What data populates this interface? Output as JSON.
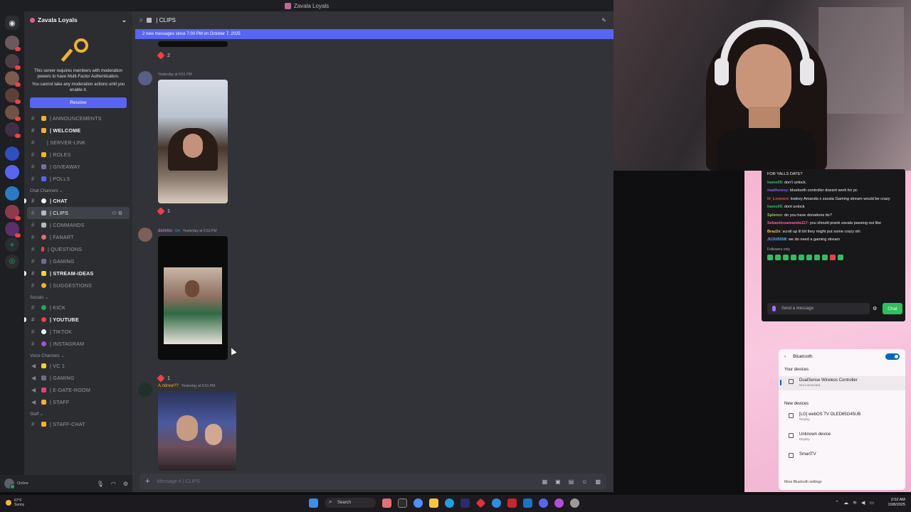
{
  "window_title": "Zavala Loyals",
  "server": {
    "name": "Zavala Loyals"
  },
  "mfa": {
    "line1": "This server requires members with moderation powers to have Multi-Factor Authentication.",
    "line2": "You cannot take any moderation actions until you enable it.",
    "button": "Resolve"
  },
  "channels_top": [
    {
      "label": "| ANNOUNCEMENTS",
      "color": "#f0b232"
    },
    {
      "label": "| WELCOME",
      "color": "#f0b232"
    },
    {
      "label": "| SERVER-LINK",
      "color": "#949ba4"
    },
    {
      "label": "| ROLES",
      "color": "#f0b232"
    },
    {
      "label": "| GIVEAWAY",
      "color": "#949ba4"
    },
    {
      "label": "| POLLS",
      "color": "#5865f2"
    }
  ],
  "cat_chat": "Chat Channels",
  "channels_chat": [
    {
      "label": "| CHAT"
    },
    {
      "label": "| CLIPS"
    },
    {
      "label": "| COMMANDS"
    },
    {
      "label": "| FANART"
    },
    {
      "label": "| QUESTIONS"
    },
    {
      "label": "| GAMING"
    },
    {
      "label": "| STREAM-IDEAS"
    },
    {
      "label": "| SUGGESTIONS"
    }
  ],
  "cat_socials": "Socials",
  "channels_socials": [
    {
      "label": "| KICK"
    },
    {
      "label": "| YOUTUBE"
    },
    {
      "label": "| TIKTOK"
    },
    {
      "label": "| INSTAGRAM"
    }
  ],
  "cat_voice": "Voice Channels",
  "channels_voice": [
    {
      "label": "| VC 1"
    },
    {
      "label": "| GAMING"
    },
    {
      "label": "| E-DATE-ROOM"
    },
    {
      "label": "| STAFF"
    }
  ],
  "cat_staff": "Staff",
  "channels_staff": [
    {
      "label": "| STAFF-CHAT"
    }
  ],
  "user_status": "Online",
  "chat": {
    "channel": "| CLIPS",
    "new_messages": "2 new messages since 7:00 PM on October 7, 2025",
    "composer_placeholder": "Message # | CLIPS"
  },
  "messages": [
    {
      "reaction": "2"
    },
    {
      "time": "Yesterday at 6:51 PM",
      "reaction": "1"
    },
    {
      "author": "dxmmo",
      "tag": "OA",
      "time": "Yesterday at 6:53 PM",
      "reaction": "1"
    },
    {
      "author": "A.ndrew??",
      "time": "Yesterday at 6:51 PM"
    }
  ],
  "twitch": {
    "lines": [
      {
        "user": "",
        "text": "FOR YALLS DATE?",
        "color": "#efeff1"
      },
      {
        "user": "hame05",
        "text": ": don't unlock.",
        "color": "#2fbf5d"
      },
      {
        "user": "matthewsy",
        "text": ": bluetooth controller doesnt work for pc",
        "color": "#8e5cff"
      },
      {
        "user": "lil_Lorenzo",
        "text": ": lowkey Amanda x zavala Gaming stream would be crazy",
        "color": "#ff4b4b"
      },
      {
        "user": "hame05",
        "text": ": dont unlock",
        "color": "#2fbf5d"
      },
      {
        "user": "Splenzz",
        "text": ": do you have donations tts?",
        "color": "#9cc94a"
      },
      {
        "user": "Sebastiosamanda117",
        "text": ": you should prank zavala passing out like",
        "color": "#ff5fa2"
      },
      {
        "user": "Braz2x",
        "text": ": scroll up lil bit they might put some crazy shi",
        "color": "#f7c948"
      },
      {
        "user": "JUJU5558",
        "text": ": we do need a gaming stream",
        "color": "#5bb1ff"
      }
    ],
    "followers_only": "Followers only",
    "placeholder": "Send a message",
    "chat_button": "Chat"
  },
  "bluetooth": {
    "title": "Bluetooth",
    "enabled": true,
    "your_devices": "Your devices",
    "device1": "DualSense Wireless Controller",
    "device1_status": "Not connected",
    "new_devices": "New devices",
    "new1": "[LG] webOS TV OLED65G45UB",
    "new1_type": "Display",
    "new2": "Unknown device",
    "new2_type": "Display",
    "new3": "SmartTV",
    "more": "More Bluetooth settings"
  },
  "taskbar": {
    "weather_temp": "67°F",
    "weather_desc": "Sunny",
    "search": "Search",
    "time": "2:02 AM",
    "date": "10/8/2025"
  }
}
